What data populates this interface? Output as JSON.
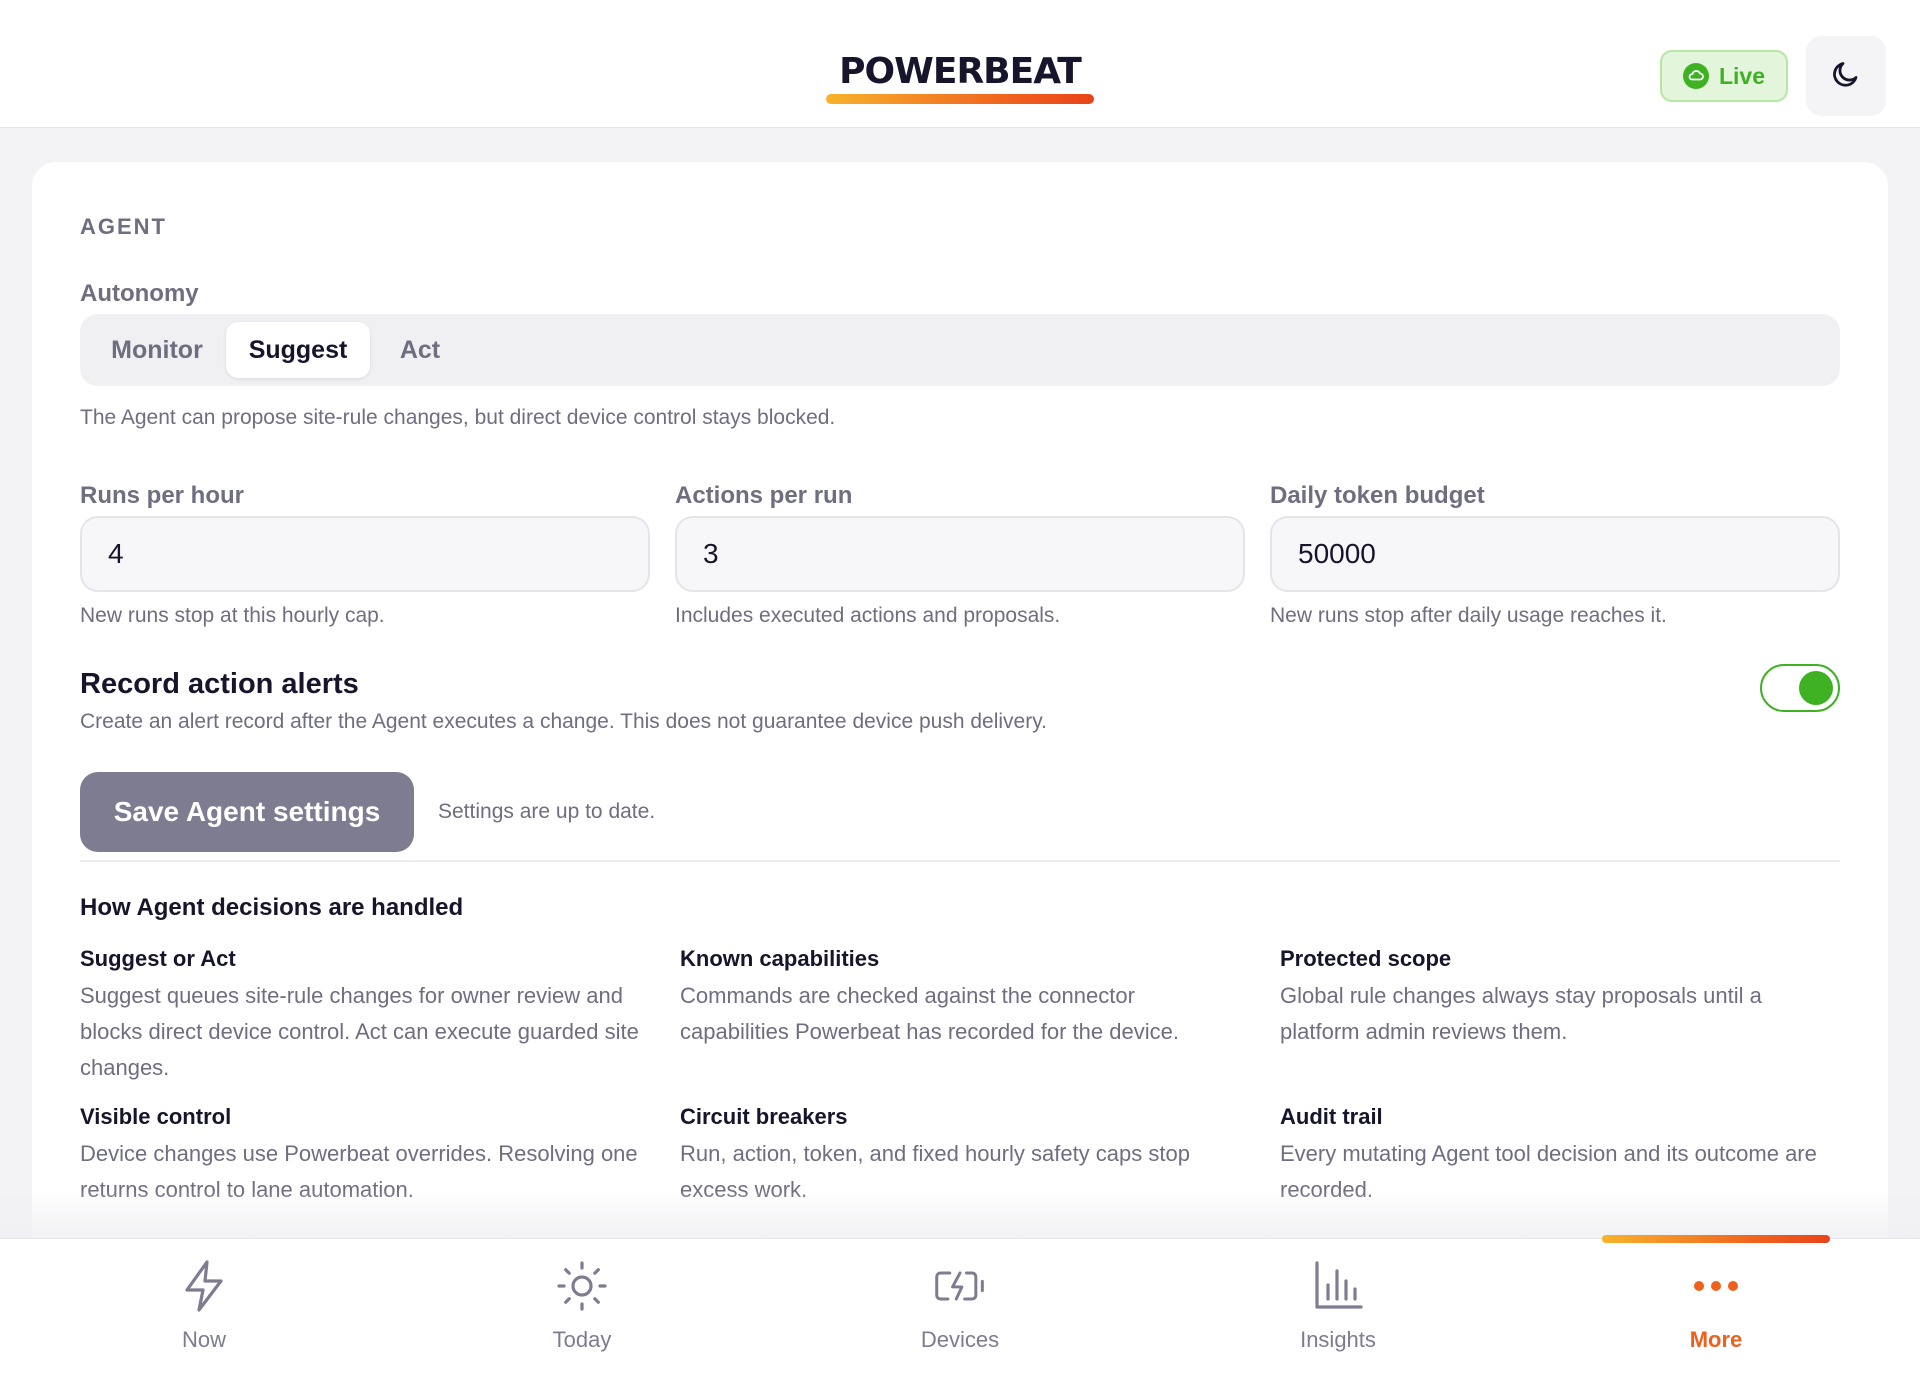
{
  "header": {
    "logo": "POWERBEAT",
    "status_label": "Live",
    "status_icon": "cloud-check-icon",
    "theme_icon": "moon-icon"
  },
  "agent": {
    "section_title": "AGENT",
    "autonomy": {
      "label": "Autonomy",
      "options": [
        "Monitor",
        "Suggest",
        "Act"
      ],
      "selected": "Suggest",
      "description": "The Agent can propose site-rule changes, but direct device control stays blocked."
    },
    "fields": [
      {
        "label": "Runs per hour",
        "value": "4",
        "help": "New runs stop at this hourly cap."
      },
      {
        "label": "Actions per run",
        "value": "3",
        "help": "Includes executed actions and proposals."
      },
      {
        "label": "Daily token budget",
        "value": "50000",
        "help": "New runs stop after daily usage reaches it."
      }
    ],
    "alerts": {
      "title": "Record action alerts",
      "description": "Create an alert record after the Agent executes a change. This does not guarantee device push delivery.",
      "enabled": true
    },
    "save": {
      "button_label": "Save Agent settings",
      "status": "Settings are up to date."
    },
    "decisions": {
      "title": "How Agent decisions are handled",
      "items": [
        {
          "title": "Suggest or Act",
          "body": "Suggest queues site-rule changes for owner review and blocks direct device control. Act can execute guarded site changes."
        },
        {
          "title": "Known capabilities",
          "body": "Commands are checked against the connector capabilities Powerbeat has recorded for the device."
        },
        {
          "title": "Protected scope",
          "body": "Global rule changes always stay proposals until a platform admin reviews them."
        },
        {
          "title": "Visible control",
          "body": "Device changes use Powerbeat overrides. Resolving one returns control to lane automation."
        },
        {
          "title": "Circuit breakers",
          "body": "Run, action, token, and fixed hourly safety caps stop excess work."
        },
        {
          "title": "Audit trail",
          "body": "Every mutating Agent tool decision and its outcome are recorded."
        }
      ]
    }
  },
  "nav": {
    "items": [
      {
        "label": "Now",
        "icon": "lightning-icon"
      },
      {
        "label": "Today",
        "icon": "sun-icon"
      },
      {
        "label": "Devices",
        "icon": "battery-charging-icon"
      },
      {
        "label": "Insights",
        "icon": "bar-chart-icon"
      },
      {
        "label": "More",
        "icon": "more-dots-icon"
      }
    ],
    "active": "More"
  },
  "colors": {
    "accent": "#f0601d",
    "success": "#3fb223",
    "text": "#16152b",
    "muted": "#6f6e80"
  }
}
